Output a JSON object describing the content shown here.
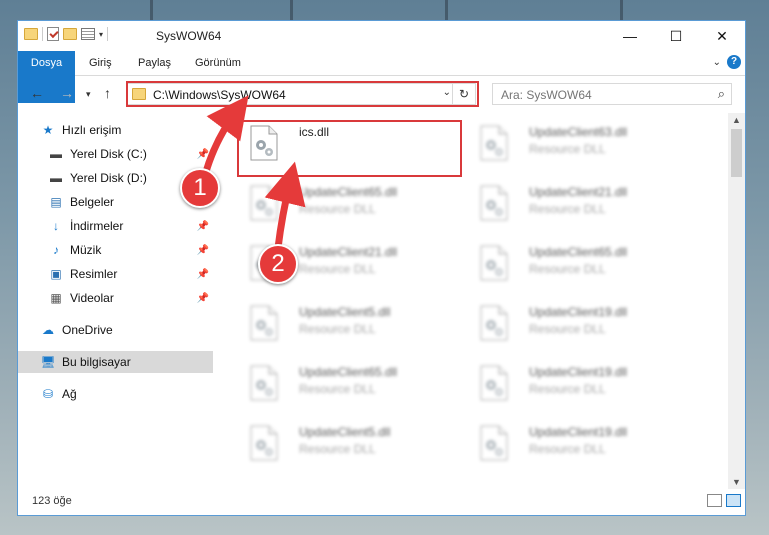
{
  "window": {
    "title": "SysWOW64",
    "controls": {
      "minimize": "—",
      "maximize": "☐",
      "close": "✕"
    }
  },
  "ribbon": {
    "tabs": [
      {
        "label": "Dosya"
      },
      {
        "label": "Giriş"
      },
      {
        "label": "Paylaş"
      },
      {
        "label": "Görünüm"
      }
    ],
    "help": "?"
  },
  "nav": {
    "address": "C:\\Windows\\SysWOW64",
    "search_placeholder": "Ara: SysWOW64"
  },
  "sidebar": {
    "items": [
      {
        "label": "Hızlı erişim",
        "icon": "star-icon"
      },
      {
        "label": "Yerel Disk (C:)",
        "icon": "drive-icon"
      },
      {
        "label": "Yerel Disk (D:)",
        "icon": "drive-icon"
      },
      {
        "label": "Belgeler",
        "icon": "document-icon"
      },
      {
        "label": "İndirmeler",
        "icon": "download-icon"
      },
      {
        "label": "Müzik",
        "icon": "music-icon"
      },
      {
        "label": "Resimler",
        "icon": "picture-icon"
      },
      {
        "label": "Videolar",
        "icon": "video-icon"
      },
      {
        "label": "OneDrive",
        "icon": "cloud-icon"
      },
      {
        "label": "Bu bilgisayar",
        "icon": "computer-icon"
      },
      {
        "label": "Ağ",
        "icon": "network-icon"
      }
    ]
  },
  "files": [
    {
      "name": "ics.dll",
      "type": ""
    },
    {
      "name": "UpdateClient63.dll",
      "type": "Resource DLL"
    },
    {
      "name": "UpdateClient65.dll",
      "type": "Resource DLL"
    },
    {
      "name": "UpdateClient21.dll",
      "type": "Resource DLL"
    },
    {
      "name": "UpdateClient21.dll",
      "type": "Resource DLL"
    },
    {
      "name": "UpdateClient65.dll",
      "type": "Resource DLL"
    },
    {
      "name": "UpdateClient5.dll",
      "type": "Resource DLL"
    },
    {
      "name": "UpdateClient19.dll",
      "type": "Resource DLL"
    },
    {
      "name": "UpdateClient65.dll",
      "type": "Resource DLL"
    },
    {
      "name": "UpdateClient19.dll",
      "type": "Resource DLL"
    },
    {
      "name": "UpdateClient5.dll",
      "type": "Resource DLL"
    },
    {
      "name": "UpdateClient19.dll",
      "type": "Resource DLL"
    }
  ],
  "status": {
    "count": "123 öğe"
  },
  "annotations": {
    "step1": "1",
    "step2": "2",
    "color": "#e53a3a"
  }
}
